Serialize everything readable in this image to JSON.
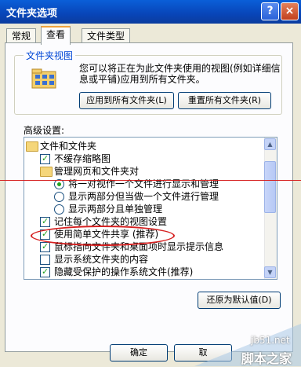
{
  "window": {
    "title": "文件夹选项",
    "help": "?",
    "close": "×"
  },
  "tabs": [
    {
      "label": "常规"
    },
    {
      "label": "查看"
    },
    {
      "label": "文件类型"
    }
  ],
  "folder_view": {
    "group_label": "文件夹视图",
    "description": "您可以将正在为此文件夹使用的视图(例如详细信息或平铺)应用到所有文件夹。",
    "apply_all": "应用到所有文件夹(L)",
    "reset_all": "重置所有文件夹(R)"
  },
  "advanced": {
    "label": "高级设置:",
    "items": [
      {
        "type": "folder",
        "label": "文件和文件夹"
      },
      {
        "type": "checkbox",
        "checked": true,
        "label": "不缓存缩略图"
      },
      {
        "type": "folder",
        "label": "管理网页和文件夹对"
      },
      {
        "type": "radio",
        "checked": true,
        "label": "将一对视作一个文件进行显示和管理"
      },
      {
        "type": "radio",
        "checked": false,
        "label": "显示两部分但当做一个文件进行管理"
      },
      {
        "type": "radio",
        "checked": false,
        "label": "显示两部分且单独管理"
      },
      {
        "type": "checkbox",
        "checked": true,
        "label": "记住每个文件夹的视图设置"
      },
      {
        "type": "checkbox",
        "checked": true,
        "label": "使用简单文件共享 (推荐)"
      },
      {
        "type": "checkbox",
        "checked": true,
        "label": "鼠标指向文件夹和桌面项时显示提示信息"
      },
      {
        "type": "checkbox",
        "checked": false,
        "label": "显示系统文件夹的内容"
      },
      {
        "type": "checkbox",
        "checked": true,
        "label": "隐藏受保护的操作系统文件(推荐)"
      }
    ]
  },
  "restore_defaults": "还原为默认值(D)",
  "ok": "确定",
  "cancel_partial": "取",
  "watermark": {
    "site": "jb51.net",
    "name": "脚本之家"
  }
}
